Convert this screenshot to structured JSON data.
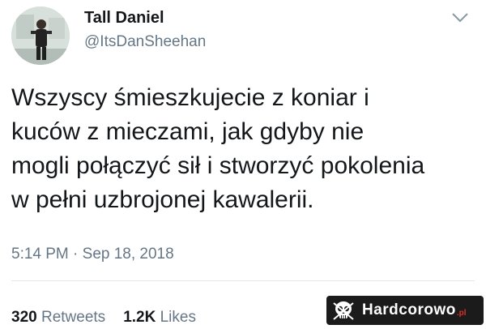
{
  "tweet": {
    "display_name": "Tall Daniel",
    "handle": "@ItsDanSheehan",
    "text": "Wszyscy śmieszkujecie z koniar i\nkuców z mieczami, jak gdyby nie\nmogli połączyć sił i stworzyć pokolenia\nw pełni uzbrojonej kawalerii.",
    "timestamp": "5:14 PM · Sep 18, 2018"
  },
  "stats": {
    "retweets_count": "320",
    "retweets_label": "Retweets",
    "likes_count": "1.2K",
    "likes_label": "Likes"
  },
  "watermark": {
    "brand": "Hardcorowo",
    "tld": ".pl"
  },
  "icons": {
    "menu": "chevron-down-icon",
    "watermark": "skull-icon"
  },
  "colors": {
    "text": "#14171a",
    "secondary": "#657786",
    "divider": "#e1e8ed",
    "watermark_bg": "#1b1b1b",
    "watermark_accent": "#d9322b"
  }
}
